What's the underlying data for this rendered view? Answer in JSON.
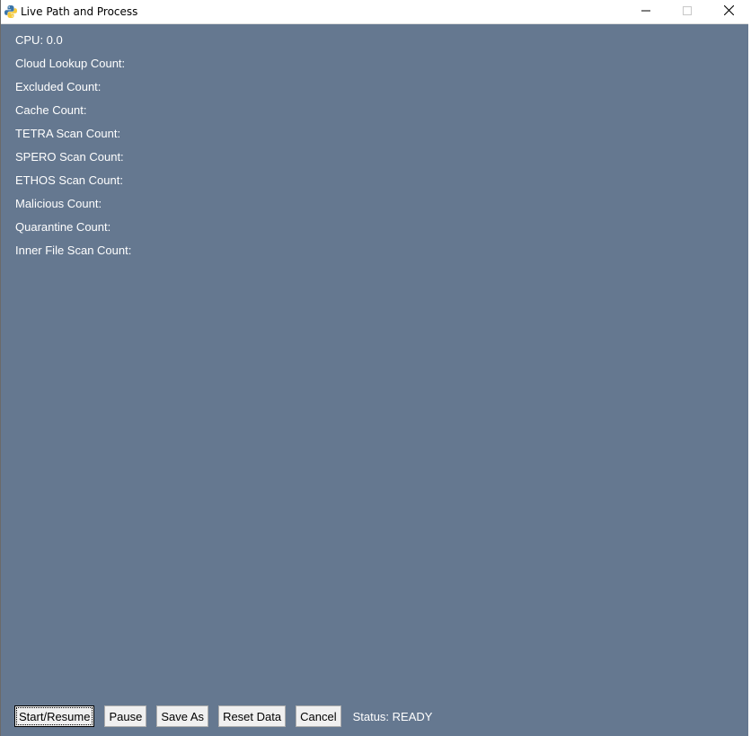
{
  "window": {
    "title": "Live Path and Process",
    "icon": "python-icon",
    "controls": [
      "minimize-icon",
      "maximize-icon",
      "close-icon"
    ]
  },
  "stats": [
    {
      "label": "CPU: 0.0"
    },
    {
      "label": "Cloud Lookup Count:"
    },
    {
      "label": "Excluded Count:"
    },
    {
      "label": "Cache Count:"
    },
    {
      "label": "TETRA Scan Count:"
    },
    {
      "label": "SPERO Scan Count:"
    },
    {
      "label": "ETHOS Scan Count:"
    },
    {
      "label": "Malicious Count:"
    },
    {
      "label": "Quarantine Count:"
    },
    {
      "label": "Inner File Scan Count:"
    }
  ],
  "toolbar": {
    "start_label": "Start/Resume",
    "pause_label": "Pause",
    "save_as_label": "Save As",
    "reset_label": "Reset Data",
    "cancel_label": "Cancel",
    "status_text": "Status: READY"
  },
  "colors": {
    "background": "#657890",
    "text": "#ffffff",
    "button_face": "#f0f0f0"
  }
}
